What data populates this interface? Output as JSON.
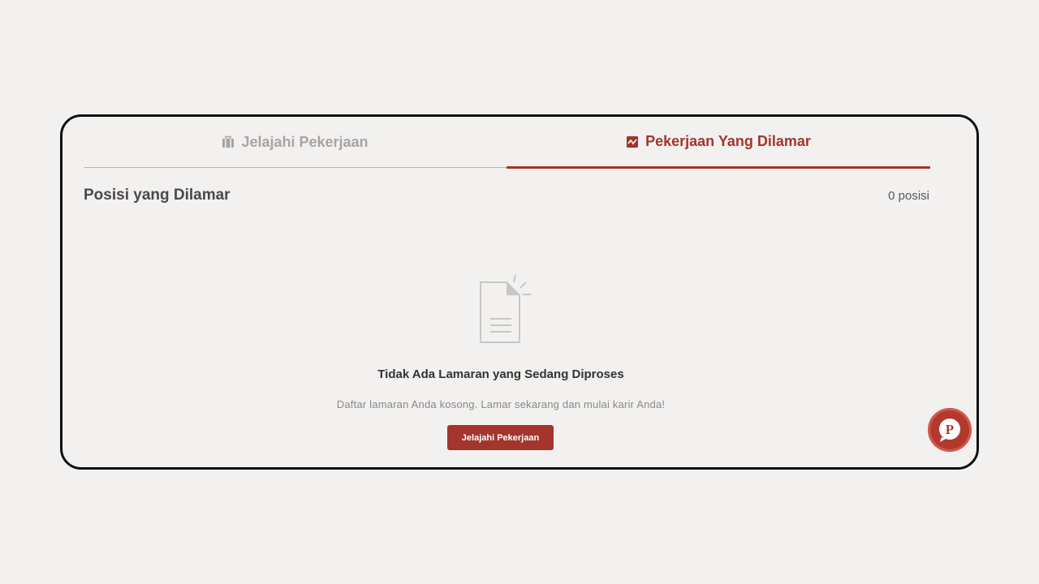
{
  "tabs": [
    {
      "label": "Jelajahi Pekerjaan",
      "icon": "briefcase-icon",
      "active": false
    },
    {
      "label": "Pekerjaan Yang Dilamar",
      "icon": "activity-chart-icon",
      "active": true
    }
  ],
  "section": {
    "title": "Posisi yang Dilamar",
    "count": "0 posisi"
  },
  "empty_state": {
    "icon": "empty-document-icon",
    "title": "Tidak Ada Lamaran yang Sedang Diproses",
    "description": "Daftar lamaran Anda kosong. Lamar sekarang dan mulai karir Anda!",
    "button_label": "Jelajahi Pekerjaan"
  },
  "chat_fab": {
    "icon": "chat-p-icon",
    "glyph": "P"
  },
  "colors": {
    "accent": "#a3352d",
    "background": "#f2f1f0",
    "muted_text": "#a7a5a3"
  }
}
